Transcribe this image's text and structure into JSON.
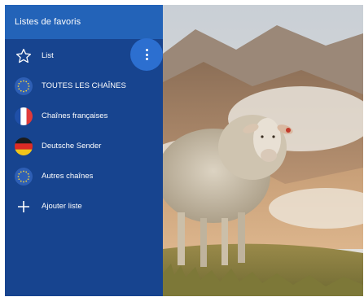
{
  "sidebar": {
    "title": "Listes de favoris",
    "items": [
      {
        "label": "List",
        "icon": "star-outline-icon"
      },
      {
        "label": "TOUTES LES CHAÎNES",
        "icon": "eu-flag-icon"
      },
      {
        "label": "Chaînes françaises",
        "icon": "france-flag-icon"
      },
      {
        "label": "Deutsche Sender",
        "icon": "germany-flag-icon"
      },
      {
        "label": "Autres chaînes",
        "icon": "eu-flag-icon"
      },
      {
        "label": "Ajouter liste",
        "icon": "plus-icon"
      }
    ],
    "more_icon": "more-vertical-icon"
  },
  "colors": {
    "sidebar": "#17448f",
    "header": "#2363b8",
    "accent_button": "#2c6fd0"
  }
}
